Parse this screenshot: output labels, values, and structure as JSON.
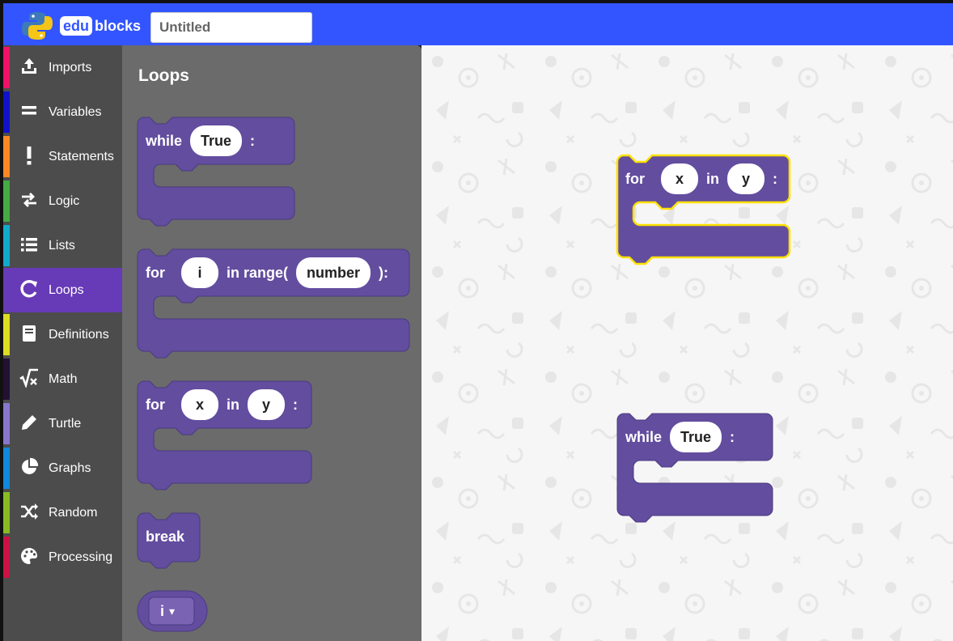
{
  "header": {
    "brand_box": "edu",
    "brand_rest": "blocks",
    "title_value": "Untitled"
  },
  "colors": {
    "topbar": "#3355ff",
    "block": "#634d9f",
    "active_category": "#673ab7",
    "selected_outline": "#ffe100"
  },
  "categories": [
    {
      "label": "Imports",
      "icon": "upload-icon",
      "color": "#ee1166"
    },
    {
      "label": "Variables",
      "icon": "equals-icon",
      "color": "#1111cc"
    },
    {
      "label": "Statements",
      "icon": "exclamation-icon",
      "color": "#ff8822"
    },
    {
      "label": "Logic",
      "icon": "swap-arrows-icon",
      "color": "#44aa44"
    },
    {
      "label": "Lists",
      "icon": "list-icon",
      "color": "#11aacc"
    },
    {
      "label": "Loops",
      "icon": "refresh-icon",
      "color": "#673ab7"
    },
    {
      "label": "Definitions",
      "icon": "book-icon",
      "color": "#dddd22"
    },
    {
      "label": "Math",
      "icon": "sqrt-icon",
      "color": "#221133"
    },
    {
      "label": "Turtle",
      "icon": "pencil-icon",
      "color": "#8877cc"
    },
    {
      "label": "Graphs",
      "icon": "pie-chart-icon",
      "color": "#1188dd"
    },
    {
      "label": "Random",
      "icon": "shuffle-icon",
      "color": "#88bb22"
    },
    {
      "label": "Processing",
      "icon": "palette-icon",
      "color": "#cc1144"
    }
  ],
  "flyout": {
    "title": "Loops",
    "blocks": {
      "while": {
        "keyword": "while",
        "arg": "True",
        "suffix": ":"
      },
      "for_range": {
        "keyword": "for",
        "var": "i",
        "mid": "in range(",
        "arg": "number",
        "suffix": "):"
      },
      "for_in": {
        "keyword": "for",
        "var": "x",
        "mid": "in",
        "arg": "y",
        "suffix": ":"
      },
      "break": {
        "keyword": "break"
      },
      "var_dropdown": {
        "value": "i",
        "caret": "▾"
      }
    }
  },
  "workspace": {
    "blocks": {
      "for_in": {
        "keyword": "for",
        "var": "x",
        "mid": "in",
        "arg": "y",
        "suffix": ":"
      },
      "while": {
        "keyword": "while",
        "arg": "True",
        "suffix": ":"
      }
    }
  }
}
